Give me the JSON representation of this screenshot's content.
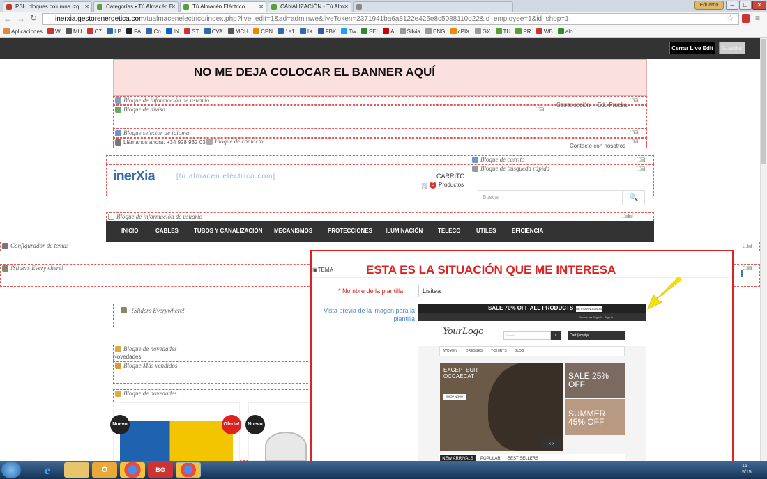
{
  "browser": {
    "tabs": [
      {
        "label": "PSH bloques columna izq",
        "color": "#c0392b"
      },
      {
        "label": "Categorías • Tú Almacén E",
        "color": "#5a9e3a"
      },
      {
        "label": "Tú Almacén Eléctrico",
        "color": "#5a9e3a"
      },
      {
        "label": "CANALIZACIÓN - Tú Alm",
        "color": "#5a9e3a"
      },
      {
        "label": "",
        "color": "#888"
      }
    ],
    "user_chip": "Eduardo",
    "url_host": "inerxia.gestorenergetica.com",
    "url_path": "/tualmacenelectrico/index.php?live_edit=1&ad=adminwe&liveToken=2371941ba6a8122e426e8c5088110d22&id_employee=1&id_shop=1",
    "bookmarks": [
      {
        "label": "Aplicaciones",
        "color": "#d84"
      },
      {
        "label": "W",
        "color": "#c33"
      },
      {
        "label": "MU",
        "color": "#555"
      },
      {
        "label": "C7",
        "color": "#c33"
      },
      {
        "label": "LP",
        "color": "#36a"
      },
      {
        "label": "PA",
        "color": "#222"
      },
      {
        "label": "Co",
        "color": "#36a"
      },
      {
        "label": "IN",
        "color": "#0a66c2"
      },
      {
        "label": "ST",
        "color": "#c33"
      },
      {
        "label": "CVA",
        "color": "#36a"
      },
      {
        "label": "MCH",
        "color": "#555"
      },
      {
        "label": "CPN",
        "color": "#e80"
      },
      {
        "label": "1e1",
        "color": "#36a"
      },
      {
        "label": "IX",
        "color": "#36a"
      },
      {
        "label": "FBK",
        "color": "#3b5998"
      },
      {
        "label": "Tw",
        "color": "#1da1f2"
      },
      {
        "label": "SEI",
        "color": "#383"
      },
      {
        "label": "A",
        "color": "#c00"
      },
      {
        "label": "Silvia",
        "color": "#999"
      },
      {
        "label": "ENG",
        "color": "#999"
      },
      {
        "label": "cPIX",
        "color": "#e80"
      },
      {
        "label": "GX",
        "color": "#999"
      },
      {
        "label": "TU",
        "color": "#5a9e3a"
      },
      {
        "label": "PR",
        "color": "#5a9e3a"
      },
      {
        "label": "WB",
        "color": "#c33"
      },
      {
        "label": "alo",
        "color": "#383"
      }
    ]
  },
  "admin": {
    "close_live": "Cerrar Live Edit",
    "save": "Guardar"
  },
  "page": {
    "banner_text": "NO ME DEJA COLOCAR EL BANNER AQUÍ",
    "hooks": {
      "user_info": "Bloque de información de usuario",
      "currency": "Bloque de divisa",
      "language": "Bloque selector de idioma",
      "contact": "Bloque de contacto",
      "cart": "Bloque de carrito",
      "search": "Bloque de búsqueda rápida",
      "menu_overlap": "Bloque de información de usuario",
      "theme_config": "Configurador de temas",
      "sliders1": "!Sliders Everywhere!",
      "sliders2": "!Sliders Everywhere!",
      "new1": "Bloque de novedades",
      "best": "Bloque Más vendidos",
      "new2": "Bloque de novedades"
    },
    "logout": "Cerrar sesión",
    "user_name": "Edu Prueba",
    "call_now": "Llámanos ahora: +34 928 932 036",
    "contact_us": "Contacte con nosotros",
    "logo_main": "inerXia",
    "logo_sub": "[tu almacén eléctrico.com]",
    "cart_title": "CARRITO:",
    "cart_count": "0",
    "cart_products": "Productos",
    "search_placeholder": "Buscar",
    "nav": [
      "INICIO",
      "CABLES",
      "TUBOS Y CANALIZACIÓN",
      "MECANISMOS",
      "PROTECCIONES",
      "ILUMINACIÓN",
      "TELECO",
      "UTILES",
      "EFICIENCIA"
    ],
    "novedades": "Novedades",
    "badges": {
      "new": "Nuevo",
      "offer": "Oferta!"
    }
  },
  "panel": {
    "title": "ESTA ES LA SITUACIÓN QUE ME INTERESA",
    "tema": "TEMA",
    "tpl_label": "Nombre de la plantilla",
    "tpl_value": "Lisitea",
    "preview_label": "Vista previa de la imagen para la plantilla",
    "preview": {
      "sale": "SALE 70% OFF ALL PRODUCTS",
      "savings": "GET SAVINGS NOW",
      "contact": "Contact us   English ·   Sign in",
      "logo": "YourLogo",
      "search": "Search",
      "cart": "Cart (empty)",
      "menu": [
        "WOMEN",
        "DRESSES",
        "T-SHIRTS",
        "BLOG"
      ],
      "hero_title": "EXCEPTEUR OCCAECAT",
      "shop_now": "SHOP NOW !",
      "side1": "SALE 25% OFF",
      "side2": "SUMMER 45% OFF",
      "tabs": [
        "NEW ARRIVALS",
        "POPULAR",
        "BEST SELLERS"
      ]
    }
  },
  "taskbar": {
    "clock": "15\n5/15"
  }
}
